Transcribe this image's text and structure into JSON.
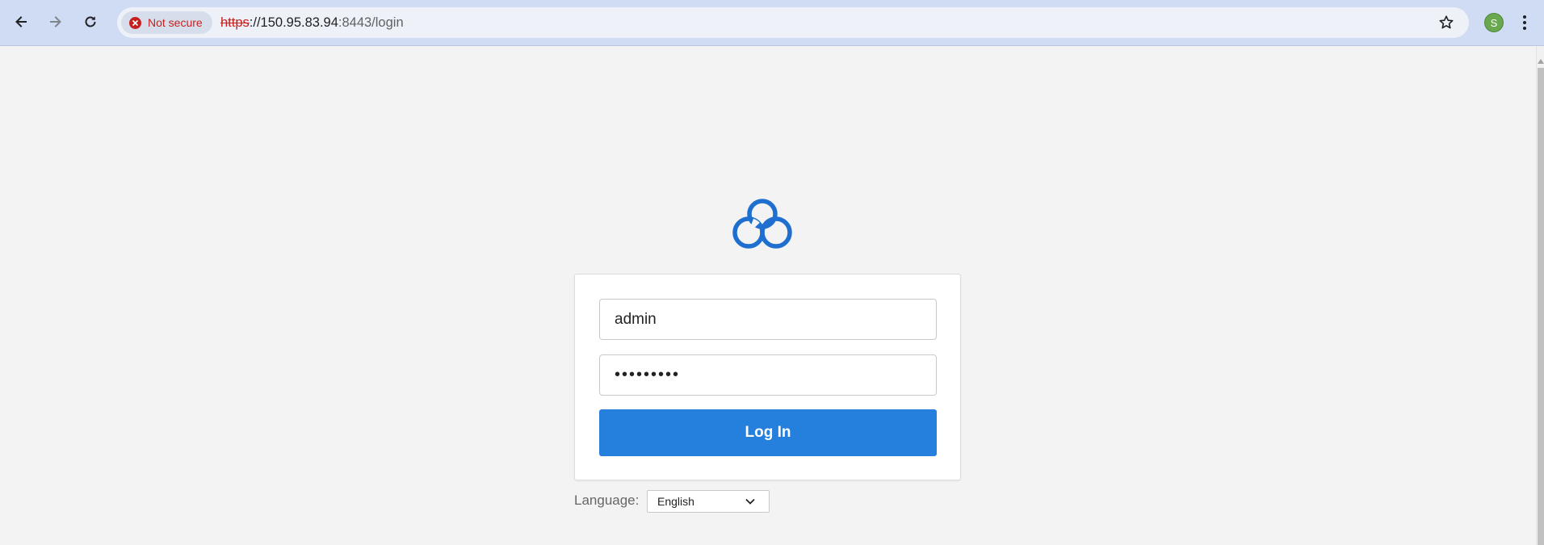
{
  "browser": {
    "security_label": "Not secure",
    "url_scheme": "https",
    "url_host": "://150.95.83.94",
    "url_path": ":8443/login",
    "profile_initial": "S"
  },
  "login": {
    "username_value": "admin",
    "password_value": "•••••••••",
    "login_button_label": "Log In"
  },
  "language": {
    "label": "Language:",
    "selected": "English"
  },
  "colors": {
    "accent": "#247fdd",
    "logo": "#1e6fcf",
    "not_secure": "#c5221f"
  },
  "icons": {
    "back": "arrow-left-icon",
    "forward": "arrow-right-icon",
    "reload": "reload-icon",
    "warning": "error-circle-icon",
    "bookmark": "star-outline-icon",
    "menu": "kebab-menu-icon",
    "logo": "cloud-logo-icon",
    "dropdown": "chevron-down-icon"
  }
}
